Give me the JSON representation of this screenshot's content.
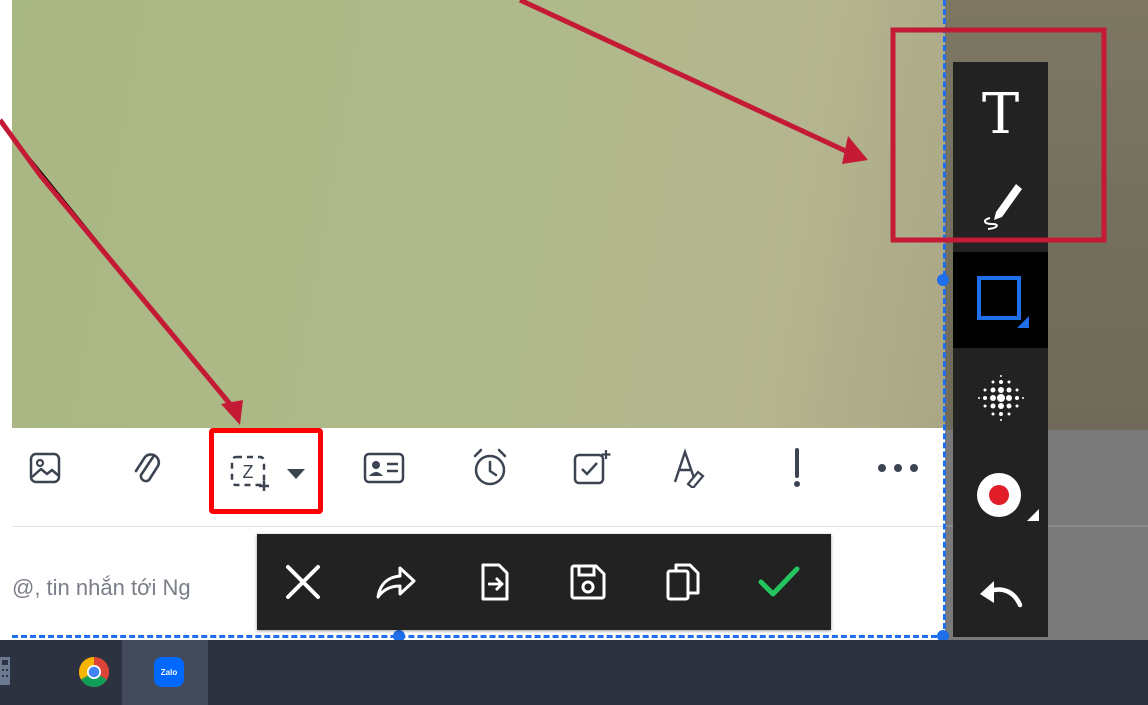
{
  "colors": {
    "accent_blue": "#1f6feb",
    "annotation_red": "#c41a36",
    "highlight_red": "#ff0000",
    "toolbar_dark": "#222222",
    "taskbar": "#2d3241",
    "confirm_green": "#22c55e",
    "record_red": "#e11d2a"
  },
  "chat_toolbar": {
    "icons": [
      "image-icon",
      "paperclip-icon",
      "screenshot-capture-icon",
      "dropdown-caret-icon",
      "contact-card-icon",
      "alarm-clock-icon",
      "task-checkbox-icon",
      "text-format-icon",
      "important-exclamation-icon",
      "more-dots-icon"
    ],
    "capture_glyph": "Z"
  },
  "compose": {
    "placeholder": "@, tin nhắn tới Ng"
  },
  "capture_actions": {
    "icons": [
      "close-icon",
      "share-forward-icon",
      "send-to-chat-icon",
      "save-disk-icon",
      "copy-icon",
      "confirm-check-icon"
    ]
  },
  "capture_tools": {
    "icons": [
      "text-tool-icon",
      "pen-tool-icon",
      "rectangle-tool-icon",
      "blur-tool-icon",
      "record-dot-icon",
      "undo-icon"
    ],
    "text_glyph": "T",
    "selected": "rectangle-tool-icon"
  },
  "taskbar": {
    "apps": [
      "calculator-icon",
      "chrome-icon",
      "zalo-icon"
    ],
    "zalo_label": "Zalo"
  }
}
